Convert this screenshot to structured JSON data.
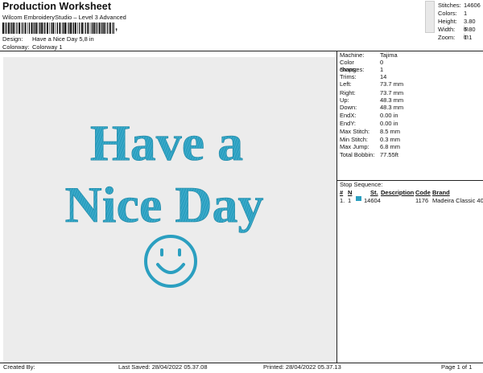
{
  "header": {
    "title": "Production Worksheet",
    "subtitle": "Wilcom EmbroideryStudio – Level 3 Advanced",
    "barcode_suffix": ","
  },
  "meta": {
    "design_label": "Design:",
    "design_value": "Have a Nice Day 5,8 in",
    "colorway_label": "Colorway:",
    "colorway_value": "Colorway 1"
  },
  "stats": [
    {
      "key": "Stitches:",
      "value": "14606"
    },
    {
      "key": "Colors:",
      "value": "1"
    },
    {
      "key": "Height:",
      "value": "3.80 in"
    },
    {
      "key": "Width:",
      "value": "5.80 in"
    },
    {
      "key": "Zoom:",
      "value": "1:1"
    }
  ],
  "design": {
    "line1": "Have a",
    "line2": "Nice Day",
    "thread_color": "#2b9fc0",
    "background_color": "#ececec",
    "smiley_icon": "smiley-face-icon"
  },
  "machine_info": [
    {
      "key": "Machine:",
      "value": "Tajima"
    },
    {
      "key": "Color changes:",
      "value": "0"
    },
    {
      "key": "Stops:",
      "value": "1"
    },
    {
      "key": "Trims:",
      "value": "14"
    },
    {
      "key": "Left:",
      "value": "73.7 mm"
    },
    {
      "key": "Right:",
      "value": "73.7 mm"
    },
    {
      "key": "Up:",
      "value": "48.3 mm"
    },
    {
      "key": "Down:",
      "value": "48.3 mm"
    },
    {
      "key": "EndX:",
      "value": "0.00 in"
    },
    {
      "key": "EndY:",
      "value": "0.00 in"
    },
    {
      "key": "Max Stitch:",
      "value": "8.5 mm"
    },
    {
      "key": "Min Stitch:",
      "value": "0.3 mm"
    },
    {
      "key": "Max Jump:",
      "value": "6.8 mm"
    },
    {
      "key": "Total Bobbin:",
      "value": "77.55ft"
    }
  ],
  "stop_sequence": {
    "label": "Stop Sequence:",
    "headers": {
      "num": "#",
      "n": "N",
      "st": "St.",
      "description": "Description",
      "code": "Code",
      "brand": "Brand"
    },
    "rows": [
      {
        "num": "1.",
        "n": "1",
        "st": "14604",
        "description": "",
        "code": "1176",
        "brand": "Madeira Classic 40",
        "color": "#2b9fc0"
      }
    ]
  },
  "footer": {
    "created_by": "Created By:",
    "last_saved": "Last Saved: 28/04/2022 05.37.08",
    "printed": "Printed: 28/04/2022 05.37.13",
    "page": "Page 1 of 1"
  }
}
